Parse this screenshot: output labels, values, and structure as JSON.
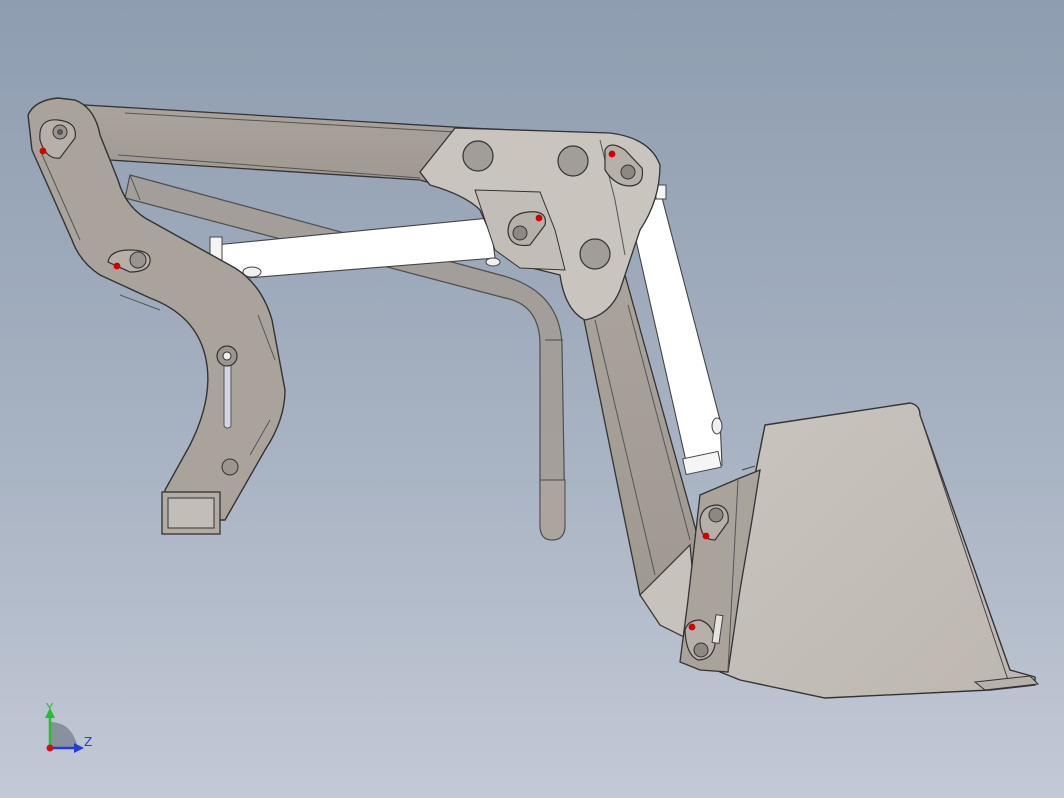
{
  "viewport": {
    "background_top": "#8e9db0",
    "background_bottom": "#c3c9d6"
  },
  "model": {
    "part_color": "#a9a29c",
    "light_part_color": "#c8c3bd",
    "cylinder_color": "#ffffff",
    "pin_marker_color": "#d40000",
    "edge_color": "#3a3a3a"
  },
  "triad": {
    "y_label": "Y",
    "z_label": "Z",
    "y_color": "#22c02a",
    "z_color": "#1f3fd6",
    "x_color": "#d01010"
  }
}
